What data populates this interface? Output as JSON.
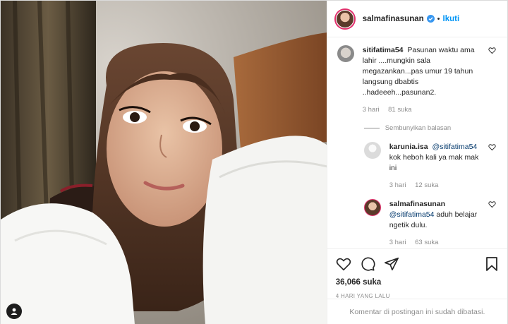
{
  "header": {
    "username": "salmafinasunan",
    "separator": "•",
    "follow_label": "Ikuti"
  },
  "comments": [
    {
      "username": "sitifatima54",
      "text": "Pasunan waktu ama lahir ....mungkin sala megazankan...pas umur 19 tahun langsung dbabtis ..hadeeeh...pasunan2.",
      "time": "3 hari",
      "likes": "81 suka"
    }
  ],
  "hide_replies_label": "Sembunyikan balasan",
  "replies": [
    {
      "username": "karunia.isa",
      "mention": "@sitifatima54",
      "text": "kok heboh kali ya mak mak ini",
      "time": "3 hari",
      "likes": "12 suka"
    },
    {
      "username": "salmafinasunan",
      "mention": "@sitifatima54",
      "text": "aduh belajar ngetik dulu.",
      "time": "3 hari",
      "likes": "63 suka"
    }
  ],
  "actions": {
    "like_count": "36,066 suka",
    "posted_time": "4 HARI YANG LALU"
  },
  "footer": {
    "comments_disabled": "Komentar di postingan ini sudah dibatasi."
  },
  "icons": {
    "like": "heart-icon",
    "comment": "comment-icon",
    "share": "share-icon",
    "save": "bookmark-icon",
    "verified": "verified-badge-icon"
  },
  "colors": {
    "accent": "#0095f6",
    "muted": "#8e8e8e",
    "text": "#262626",
    "border": "#efefef"
  }
}
